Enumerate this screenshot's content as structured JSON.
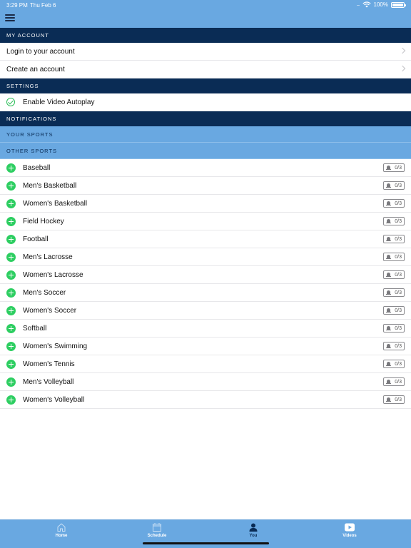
{
  "status_bar": {
    "time": "3:29 PM",
    "date": "Thu Feb 6",
    "signal": "....",
    "battery": "100%",
    "battery_level": 1.0
  },
  "nav": {
    "menu_icon": "hamburger-menu-icon"
  },
  "my_account": {
    "header": "MY ACCOUNT",
    "items": [
      {
        "label": "Login to your account"
      },
      {
        "label": "Create an account"
      }
    ]
  },
  "settings": {
    "header": "SETTINGS",
    "autoplay_label": "Enable Video Autoplay",
    "autoplay_enabled": true
  },
  "notifications": {
    "header": "NOTIFICATIONS",
    "your_sports_header": "YOUR SPORTS",
    "other_sports_header": "OTHER SPORTS",
    "sports": [
      {
        "name": "Baseball",
        "count": "0/3"
      },
      {
        "name": "Men's Basketball",
        "count": "0/3"
      },
      {
        "name": "Women's Basketball",
        "count": "0/3"
      },
      {
        "name": "Field Hockey",
        "count": "0/3"
      },
      {
        "name": "Football",
        "count": "0/3"
      },
      {
        "name": "Men's Lacrosse",
        "count": "0/3"
      },
      {
        "name": "Women's Lacrosse",
        "count": "0/3"
      },
      {
        "name": "Men's Soccer",
        "count": "0/3"
      },
      {
        "name": "Women's Soccer",
        "count": "0/3"
      },
      {
        "name": "Softball",
        "count": "0/3"
      },
      {
        "name": "Women's Swimming",
        "count": "0/3"
      },
      {
        "name": "Women's Tennis",
        "count": "0/3"
      },
      {
        "name": "Men's Volleyball",
        "count": "0/3"
      },
      {
        "name": "Women's Volleyball",
        "count": "0/3"
      }
    ]
  },
  "tabs": [
    {
      "label": "Home",
      "icon": "home-icon"
    },
    {
      "label": "Schedule",
      "icon": "calendar-icon"
    },
    {
      "label": "You",
      "icon": "person-icon"
    },
    {
      "label": "Videos",
      "icon": "play-icon"
    }
  ],
  "colors": {
    "nav_blue": "#69a8e1",
    "section_navy": "#0a2c55",
    "accent_green": "#2dce61"
  }
}
